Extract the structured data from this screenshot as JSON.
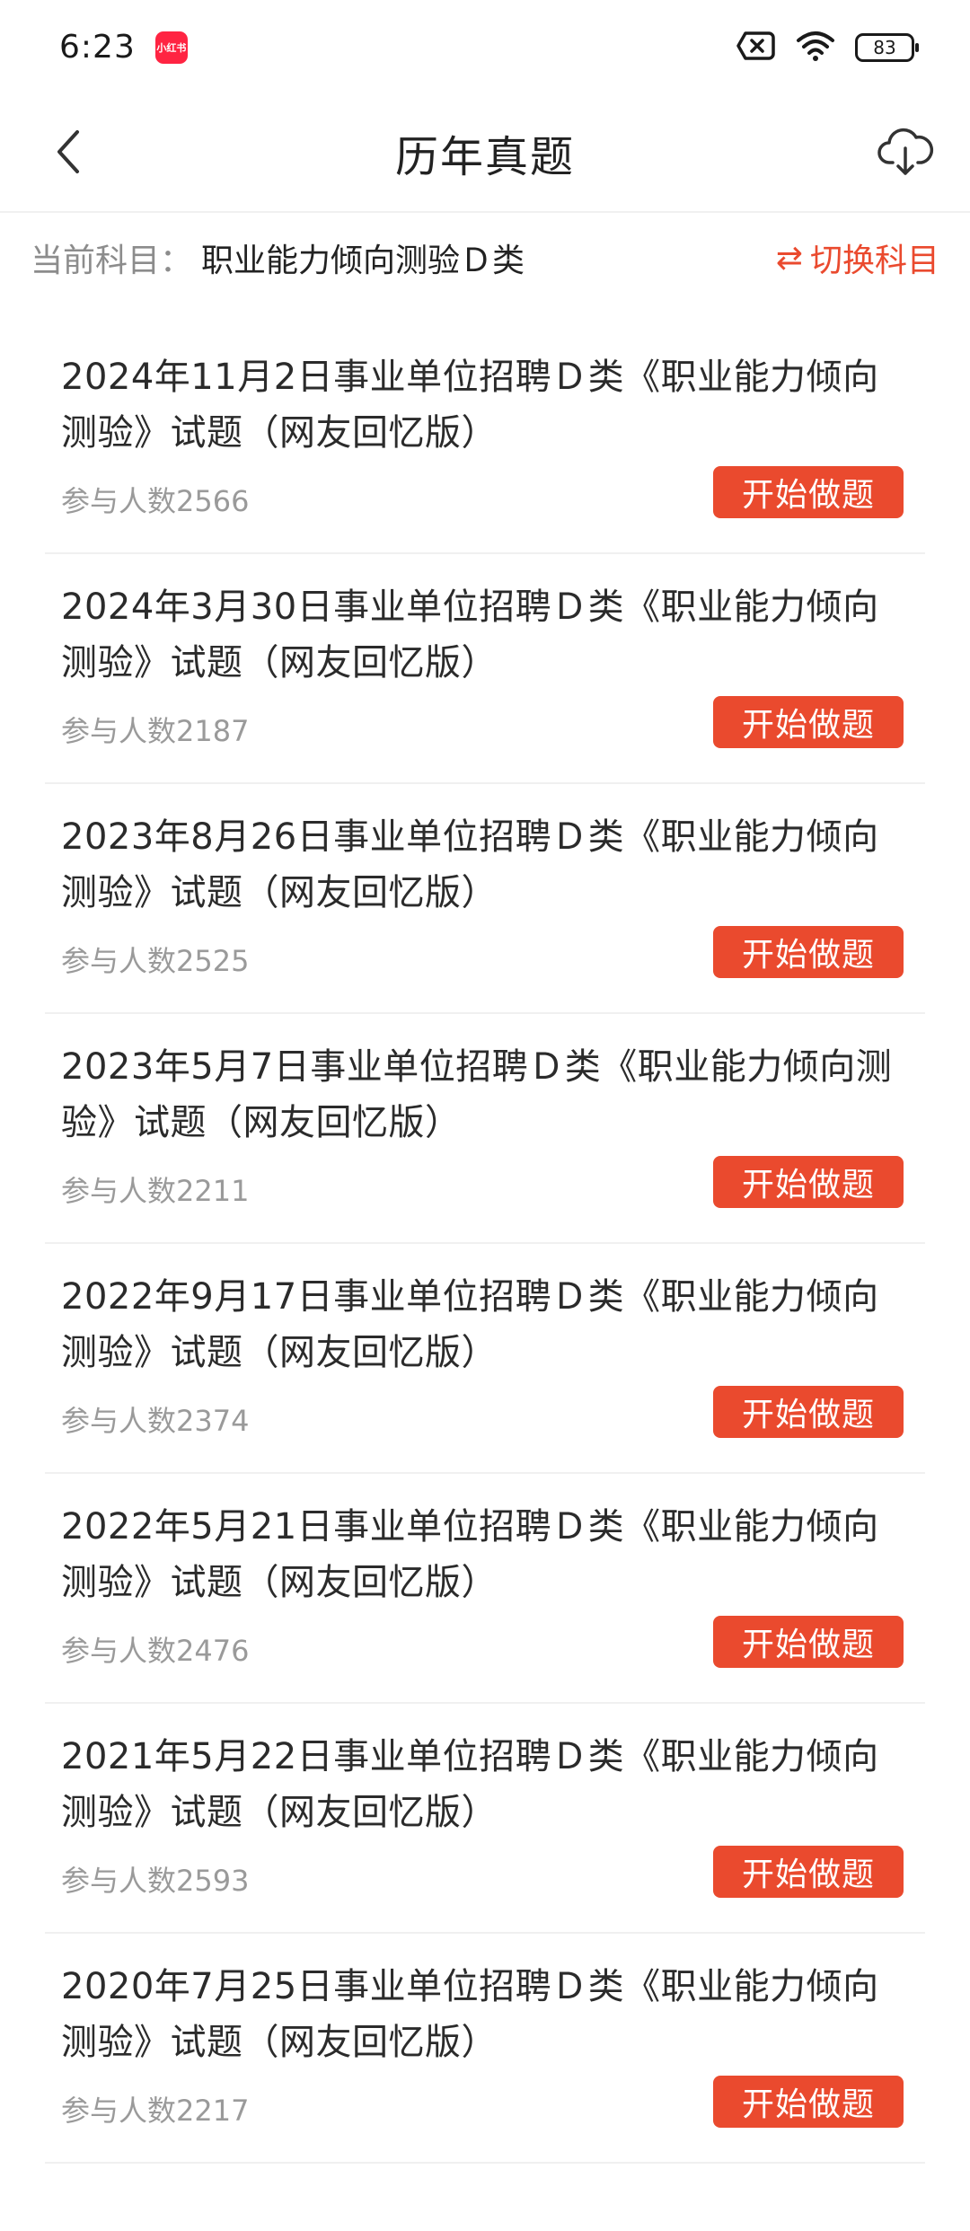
{
  "status_bar": {
    "time": "6:23",
    "app_badge": "小红书",
    "battery": "83"
  },
  "header": {
    "title": "历年真题"
  },
  "subject": {
    "label": "当前科目：",
    "value": "职业能力倾向测验Ｄ类",
    "switch_label": "切换科目",
    "switch_icon": "⇄"
  },
  "exams": [
    {
      "title": "2024年11月2日事业单位招聘Ｄ类《职业能力倾向测验》试题（网友回忆版）",
      "participants": "参与人数2566",
      "button": "开始做题"
    },
    {
      "title": "2024年3月30日事业单位招聘Ｄ类《职业能力倾向测验》试题（网友回忆版）",
      "participants": "参与人数2187",
      "button": "开始做题"
    },
    {
      "title": "2023年8月26日事业单位招聘Ｄ类《职业能力倾向测验》试题（网友回忆版）",
      "participants": "参与人数2525",
      "button": "开始做题"
    },
    {
      "title": "2023年5月7日事业单位招聘Ｄ类《职业能力倾向测验》试题（网友回忆版）",
      "participants": "参与人数2211",
      "button": "开始做题"
    },
    {
      "title": "2022年9月17日事业单位招聘Ｄ类《职业能力倾向测验》试题（网友回忆版）",
      "participants": "参与人数2374",
      "button": "开始做题"
    },
    {
      "title": "2022年5月21日事业单位招聘Ｄ类《职业能力倾向测验》试题（网友回忆版）",
      "participants": "参与人数2476",
      "button": "开始做题"
    },
    {
      "title": "2021年5月22日事业单位招聘Ｄ类《职业能力倾向测验》试题（网友回忆版）",
      "participants": "参与人数2593",
      "button": "开始做题"
    },
    {
      "title": "2020年7月25日事业单位招聘Ｄ类《职业能力倾向测验》试题（网友回忆版）",
      "participants": "参与人数2217",
      "button": "开始做题"
    }
  ],
  "colors": {
    "accent": "#ea4a2e",
    "app_badge": "#ff2442"
  },
  "icons": {
    "back": "chevron-left-icon",
    "download": "cloud-download-icon",
    "switch": "swap-arrows-icon",
    "no-sim": "no-sim-icon",
    "wifi": "wifi-icon",
    "battery": "battery-icon"
  }
}
